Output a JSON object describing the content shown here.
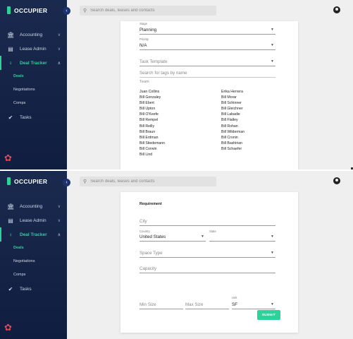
{
  "app": {
    "name": "OCCUPIER"
  },
  "search": {
    "placeholder": "Search deals, leases and contacts"
  },
  "sidebar": {
    "items": [
      {
        "label": "Accounting",
        "icon": "bank-icon"
      },
      {
        "label": "Lease Admin",
        "icon": "document-icon"
      },
      {
        "label": "Deal Tracker",
        "icon": "handshake-icon"
      },
      {
        "label": "Tasks",
        "icon": "check-circle-icon"
      }
    ],
    "deal_tracker_subitems": [
      "Deals",
      "Negotiations",
      "Comps"
    ]
  },
  "form1": {
    "stage_label": "Stage",
    "stage_value": "Planning",
    "priority_label": "Priority",
    "priority_value": "N/A",
    "task_template_placeholder": "Task Template",
    "tag_search_placeholder": "Search for tags by name",
    "team_label": "Team",
    "team_left": [
      "Juan Collins",
      "Bill Gonzaley",
      "Bill Ebert",
      "Bill Upton",
      "Bill O'Keefe",
      "Bill Rempel",
      "Bill Reilly",
      "Bill Braun",
      "Bill Erdman",
      "Bill Stiedemann",
      "Bill Corwin",
      "Bill Lind"
    ],
    "team_right": [
      "Erika Herrera",
      "Bill Morar",
      "Bill Schinner",
      "Bill Gleichner",
      "Bill Labadie",
      "Bill Flatley",
      "Bill Rohan",
      "Bill Wilderman",
      "Bill Cronin",
      "Bill Bashirian",
      "Bill Schaefer"
    ]
  },
  "form2": {
    "section_title": "Requirement",
    "city_placeholder": "City",
    "country_label": "Country",
    "country_value": "United States",
    "state_label": "State",
    "space_type_placeholder": "Space Type",
    "capacity_placeholder": "Capacity",
    "min_size_placeholder": "Min Size",
    "max_size_placeholder": "Max Size",
    "unit_label": "Unit",
    "unit_value": "SF",
    "submit_label": "SUBMIT"
  },
  "colors": {
    "accent": "#2bd39a",
    "sidebar": "#14234a",
    "brand_icon": "#e8454f"
  }
}
